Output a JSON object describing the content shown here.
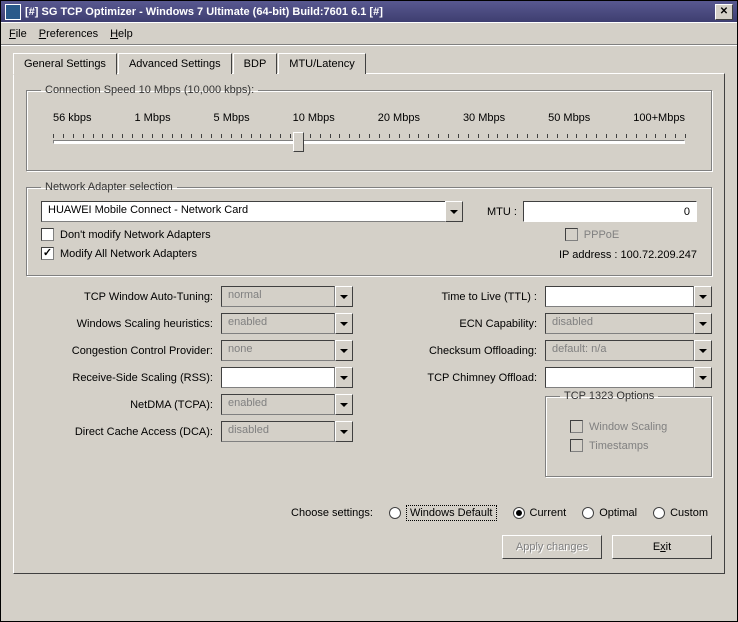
{
  "title": "[#] SG TCP Optimizer - Windows 7 Ultimate (64-bit) Build:7601 6.1  [#]",
  "menu": {
    "file": "File",
    "preferences": "Preferences",
    "help": "Help"
  },
  "tabs": {
    "general": "General Settings",
    "advanced": "Advanced Settings",
    "bdp": "BDP",
    "mtu": "MTU/Latency"
  },
  "speed": {
    "legend": "Connection Speed  10 Mbps (10,000 kbps):",
    "marks": [
      "56 kbps",
      "1 Mbps",
      "5 Mbps",
      "10 Mbps",
      "20 Mbps",
      "30 Mbps",
      "50 Mbps",
      "100+Mbps"
    ]
  },
  "network": {
    "legend": "Network Adapter selection",
    "adapter": "HUAWEI Mobile Connect - Network Card",
    "dont_modify": "Don't modify Network Adapters",
    "modify_all": "Modify All Network Adapters",
    "mtu_label": "MTU :",
    "mtu_value": "0",
    "pppoe": "PPPoE",
    "ip_label": "IP address : 100.72.209.247"
  },
  "left": {
    "auto_tuning": {
      "label": "TCP Window Auto-Tuning:",
      "value": "normal"
    },
    "heuristics": {
      "label": "Windows Scaling heuristics:",
      "value": "enabled"
    },
    "congestion": {
      "label": "Congestion Control Provider:",
      "value": "none"
    },
    "rss": {
      "label": "Receive-Side Scaling (RSS):",
      "value": ""
    },
    "netdma": {
      "label": "NetDMA (TCPA):",
      "value": "enabled"
    },
    "dca": {
      "label": "Direct Cache Access (DCA):",
      "value": "disabled"
    }
  },
  "right": {
    "ttl": {
      "label": "Time to Live (TTL) :",
      "value": ""
    },
    "ecn": {
      "label": "ECN Capability:",
      "value": "disabled"
    },
    "checksum": {
      "label": "Checksum Offloading:",
      "value": "default: n/a"
    },
    "chimney": {
      "label": "TCP Chimney Offload:",
      "value": ""
    },
    "tcp1323": {
      "legend": "TCP 1323 Options",
      "ws": "Window Scaling",
      "ts": "Timestamps"
    }
  },
  "bottom": {
    "choose": "Choose settings:",
    "default": "Windows Default",
    "current": "Current",
    "optimal": "Optimal",
    "custom": "Custom",
    "apply": "Apply changes",
    "exit": "Exit"
  }
}
